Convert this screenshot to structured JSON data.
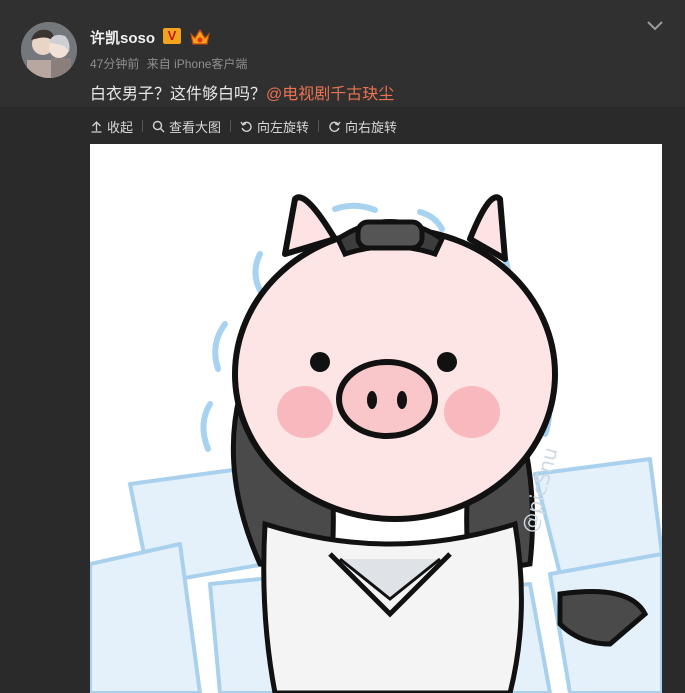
{
  "post": {
    "author": "许凯soso",
    "verified_badge": "V",
    "time": "47分钟前",
    "source_prefix": "来自",
    "source": "iPhone客户端",
    "text": "白衣男子？这件够白吗？",
    "mention": "@电视剧千古玦尘"
  },
  "toolbar": {
    "collapse": "收起",
    "view_large": "查看大图",
    "rotate_left": "向左旋转",
    "rotate_right": "向右旋转"
  },
  "image": {
    "watermark": "@picSnu"
  },
  "colors": {
    "background": "#2a2a2a",
    "header": "#303030",
    "mention": "#eb7350",
    "badge": "#f2a41c"
  }
}
